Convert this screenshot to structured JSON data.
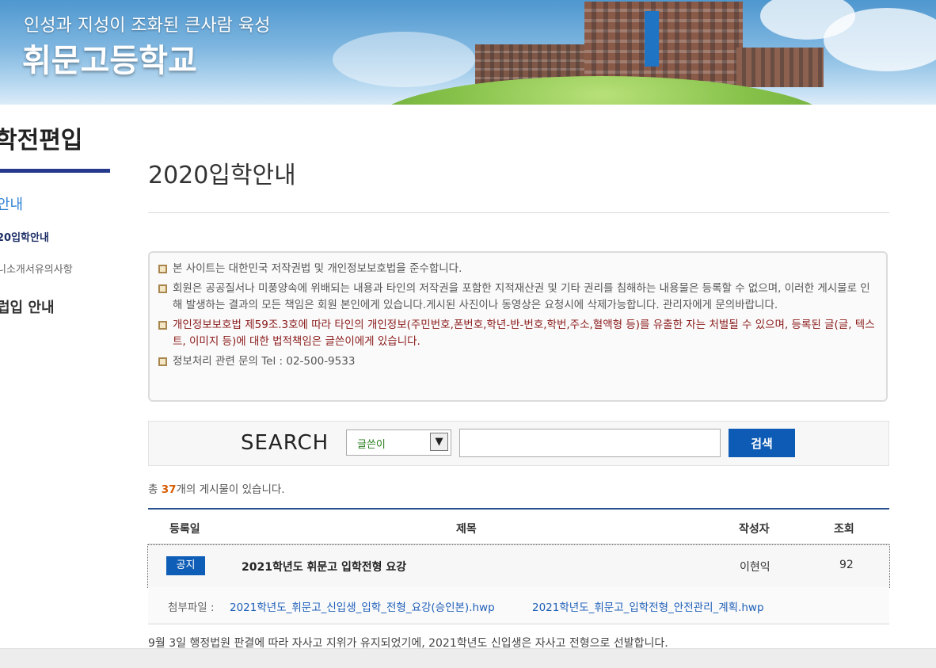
{
  "banner": {
    "slogan": "인성과 지성이 조화된 큰사람 육성",
    "school_name": "휘문고등학교"
  },
  "sidebar": {
    "title": "학전편입",
    "items": [
      {
        "label": "안내"
      },
      {
        "label": "20입학안내"
      },
      {
        "label": "니소개서유의사항"
      },
      {
        "label": "럽입 안내"
      }
    ]
  },
  "main": {
    "page_title": "2020입학안내",
    "notices": [
      "본 사이트는 대한민국 저작권법 및 개인정보보호법을 준수합니다.",
      "회원은 공공질서나 미풍양속에 위배되는 내용과 타인의 저작권을 포함한 지적재산권 및 기타 권리를 침해하는 내용물은 등록할 수 없으며, 이러한 게시물로 인해 발생하는 결과의 모든 책임은 회원 본인에게 있습니다.게시된 사진이나 동영상은 요청시에 삭제가능합니다. 관리자에게 문의바랍니다.",
      "개인정보보호법 제59조.3호에 따라 타인의 개인정보(주민번호,폰번호,학년-반-번호,학번,주소,혈액형 등)를 유출한 자는 처벌될 수 있으며, 등록된 글(글, 텍스트, 이미지 등)에 대한 법적책임은 글쓴이에게 있습니다.",
      "정보처리 관련 문의 Tel : 02-500-9533"
    ],
    "search": {
      "label": "SEARCH",
      "select_value": "글쓴이",
      "input_value": "",
      "button_label": "검색"
    },
    "count": {
      "prefix": "총 ",
      "number": "37",
      "suffix": "개의 게시물이 있습니다."
    },
    "table": {
      "headers": [
        "등록일",
        "제목",
        "작성자",
        "조회"
      ],
      "rows": [
        {
          "badge": "공지",
          "title": "2021학년도 휘문고 입학전형 요강",
          "author": "이현익",
          "views": "92"
        }
      ]
    },
    "attachments": {
      "label": "첨부파일 :",
      "files": [
        "2021학년도_휘문고_신입생_입학_전형_요강(승인본).hwp",
        "2021학년도_휘문고_입학전형_안전관리_계획.hwp"
      ]
    },
    "body_text": "9월 3일 행정법원 판결에 따라 자사고 지위가 유지되었기에, 2021학년도 신입생은 자사고 전형으로 선발합니다."
  },
  "icons": {
    "bullet": "square-bullet-icon",
    "select_arrow": "chevron-down-icon"
  },
  "colors": {
    "accent_blue": "#0d5bb5",
    "sidebar_bar": "#24398c",
    "count_highlight": "#d85c00",
    "warning_text": "#8b1a1a"
  }
}
